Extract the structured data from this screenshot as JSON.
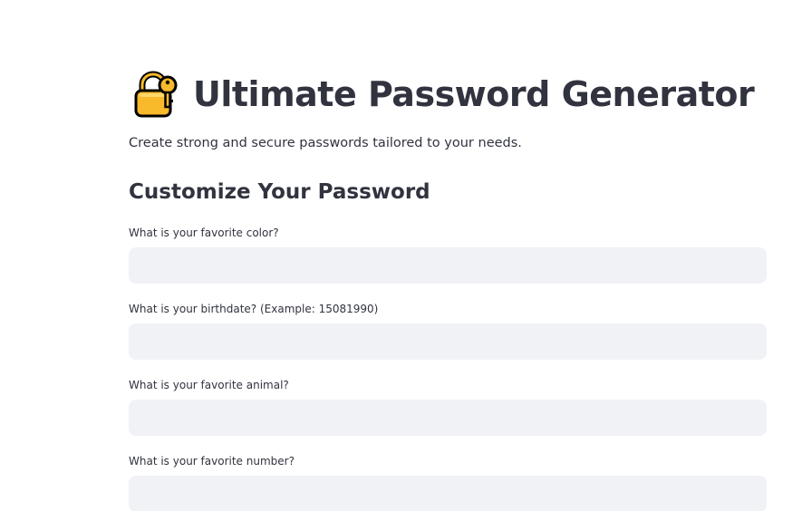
{
  "header": {
    "icon": "locked-with-key-icon",
    "title": "Ultimate Password Generator",
    "subtitle": "Create strong and secure passwords tailored to your needs."
  },
  "form": {
    "section_title": "Customize Your Password",
    "fields": [
      {
        "label": "What is your favorite color?",
        "value": "",
        "placeholder": ""
      },
      {
        "label": "What is your birthdate? (Example: 15081990)",
        "value": "",
        "placeholder": ""
      },
      {
        "label": "What is your favorite animal?",
        "value": "",
        "placeholder": ""
      },
      {
        "label": "What is your favorite number?",
        "value": "",
        "placeholder": ""
      }
    ]
  },
  "colors": {
    "text": "#31333f",
    "input_background": "#f0f2f6",
    "icon_lock": "#f8b92b",
    "icon_outline": "#000000"
  }
}
